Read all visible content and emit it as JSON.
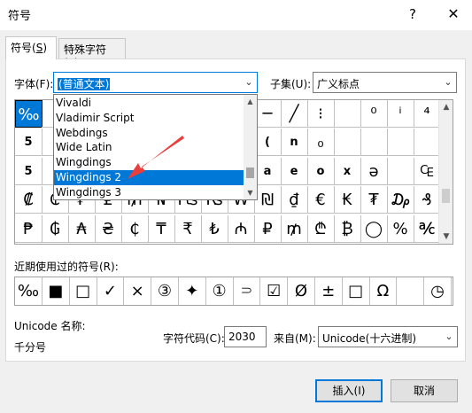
{
  "window": {
    "title": "符号",
    "help": "?",
    "close": "✕"
  },
  "tabs": [
    {
      "label": "符号(",
      "key": "S",
      "suffix": ")"
    },
    {
      "label": "特殊字符(",
      "key": "P",
      "suffix": ")"
    }
  ],
  "font": {
    "label": "字体(F):",
    "value": "(普通文本)"
  },
  "subset": {
    "label": "子集(U):",
    "value": "广义标点"
  },
  "font_dropdown": {
    "items": [
      "Vivaldi",
      "Vladimir Script",
      "Webdings",
      "Wide Latin",
      "Wingdings",
      "Wingdings 2",
      "Wingdings 3"
    ],
    "selected": "Wingdings 2"
  },
  "symbol_grid": {
    "rows": [
      [
        "‰",
        "",
        "",
        "",
        "",
        "",
        "",
        "",
        "",
        "─",
        "╱",
        "⁝",
        "",
        "⁰",
        "ⁱ",
        "⁴"
      ],
      [
        "5",
        "",
        "",
        "",
        "",
        "",
        "",
        "",
        "",
        "(",
        "n",
        "₀",
        "",
        "",
        "",
        ""
      ],
      [
        "5",
        "",
        "",
        "",
        "",
        "",
        "",
        "",
        "",
        "a",
        "e",
        "o",
        "x",
        "ə",
        "",
        "₠"
      ],
      [
        "₡",
        "₢",
        "₣",
        "₤",
        "₥",
        "₦",
        "₧",
        "₨",
        "₩",
        "₪",
        "₫",
        "€",
        "₭",
        "₮",
        "₯",
        "₰"
      ],
      [
        "₱",
        "₲",
        "₳",
        "₴",
        "₵",
        "₸",
        "₹",
        "₺",
        "₼",
        "₽",
        "₥",
        "₾",
        "₿",
        "◯",
        "%",
        "℀"
      ]
    ],
    "selected": "‰"
  },
  "recent": {
    "label": "近期使用过的符号(R):",
    "items": [
      "‰",
      "■",
      "□",
      "✓",
      "×",
      "③",
      "✦",
      "①",
      "⸧",
      "☑",
      "Ø",
      "±",
      "□",
      "Ω",
      "",
      "◷"
    ]
  },
  "unicode_name": {
    "label": "Unicode 名称:",
    "value": "千分号"
  },
  "char_code": {
    "label": "字符代码(C):",
    "value": "2030"
  },
  "from": {
    "label": "来自(M):",
    "value": "Unicode(十六进制)"
  },
  "buttons": {
    "insert": "插入(I)",
    "cancel": "取消"
  }
}
